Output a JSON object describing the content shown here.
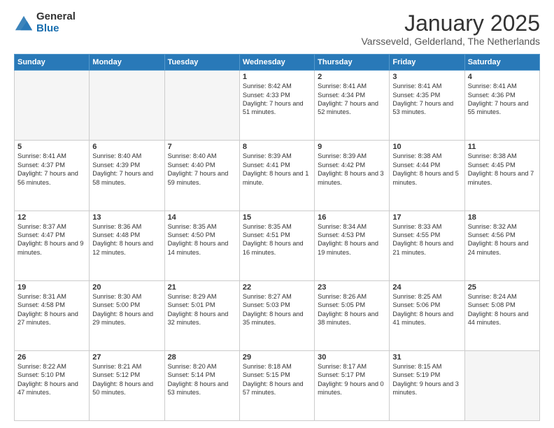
{
  "header": {
    "logo_general": "General",
    "logo_blue": "Blue",
    "month_title": "January 2025",
    "location": "Varsseveld, Gelderland, The Netherlands"
  },
  "days_of_week": [
    "Sunday",
    "Monday",
    "Tuesday",
    "Wednesday",
    "Thursday",
    "Friday",
    "Saturday"
  ],
  "weeks": [
    [
      {
        "day": "",
        "info": ""
      },
      {
        "day": "",
        "info": ""
      },
      {
        "day": "",
        "info": ""
      },
      {
        "day": "1",
        "info": "Sunrise: 8:42 AM\nSunset: 4:33 PM\nDaylight: 7 hours\nand 51 minutes."
      },
      {
        "day": "2",
        "info": "Sunrise: 8:41 AM\nSunset: 4:34 PM\nDaylight: 7 hours\nand 52 minutes."
      },
      {
        "day": "3",
        "info": "Sunrise: 8:41 AM\nSunset: 4:35 PM\nDaylight: 7 hours\nand 53 minutes."
      },
      {
        "day": "4",
        "info": "Sunrise: 8:41 AM\nSunset: 4:36 PM\nDaylight: 7 hours\nand 55 minutes."
      }
    ],
    [
      {
        "day": "5",
        "info": "Sunrise: 8:41 AM\nSunset: 4:37 PM\nDaylight: 7 hours\nand 56 minutes."
      },
      {
        "day": "6",
        "info": "Sunrise: 8:40 AM\nSunset: 4:39 PM\nDaylight: 7 hours\nand 58 minutes."
      },
      {
        "day": "7",
        "info": "Sunrise: 8:40 AM\nSunset: 4:40 PM\nDaylight: 7 hours\nand 59 minutes."
      },
      {
        "day": "8",
        "info": "Sunrise: 8:39 AM\nSunset: 4:41 PM\nDaylight: 8 hours\nand 1 minute."
      },
      {
        "day": "9",
        "info": "Sunrise: 8:39 AM\nSunset: 4:42 PM\nDaylight: 8 hours\nand 3 minutes."
      },
      {
        "day": "10",
        "info": "Sunrise: 8:38 AM\nSunset: 4:44 PM\nDaylight: 8 hours\nand 5 minutes."
      },
      {
        "day": "11",
        "info": "Sunrise: 8:38 AM\nSunset: 4:45 PM\nDaylight: 8 hours\nand 7 minutes."
      }
    ],
    [
      {
        "day": "12",
        "info": "Sunrise: 8:37 AM\nSunset: 4:47 PM\nDaylight: 8 hours\nand 9 minutes."
      },
      {
        "day": "13",
        "info": "Sunrise: 8:36 AM\nSunset: 4:48 PM\nDaylight: 8 hours\nand 12 minutes."
      },
      {
        "day": "14",
        "info": "Sunrise: 8:35 AM\nSunset: 4:50 PM\nDaylight: 8 hours\nand 14 minutes."
      },
      {
        "day": "15",
        "info": "Sunrise: 8:35 AM\nSunset: 4:51 PM\nDaylight: 8 hours\nand 16 minutes."
      },
      {
        "day": "16",
        "info": "Sunrise: 8:34 AM\nSunset: 4:53 PM\nDaylight: 8 hours\nand 19 minutes."
      },
      {
        "day": "17",
        "info": "Sunrise: 8:33 AM\nSunset: 4:55 PM\nDaylight: 8 hours\nand 21 minutes."
      },
      {
        "day": "18",
        "info": "Sunrise: 8:32 AM\nSunset: 4:56 PM\nDaylight: 8 hours\nand 24 minutes."
      }
    ],
    [
      {
        "day": "19",
        "info": "Sunrise: 8:31 AM\nSunset: 4:58 PM\nDaylight: 8 hours\nand 27 minutes."
      },
      {
        "day": "20",
        "info": "Sunrise: 8:30 AM\nSunset: 5:00 PM\nDaylight: 8 hours\nand 29 minutes."
      },
      {
        "day": "21",
        "info": "Sunrise: 8:29 AM\nSunset: 5:01 PM\nDaylight: 8 hours\nand 32 minutes."
      },
      {
        "day": "22",
        "info": "Sunrise: 8:27 AM\nSunset: 5:03 PM\nDaylight: 8 hours\nand 35 minutes."
      },
      {
        "day": "23",
        "info": "Sunrise: 8:26 AM\nSunset: 5:05 PM\nDaylight: 8 hours\nand 38 minutes."
      },
      {
        "day": "24",
        "info": "Sunrise: 8:25 AM\nSunset: 5:06 PM\nDaylight: 8 hours\nand 41 minutes."
      },
      {
        "day": "25",
        "info": "Sunrise: 8:24 AM\nSunset: 5:08 PM\nDaylight: 8 hours\nand 44 minutes."
      }
    ],
    [
      {
        "day": "26",
        "info": "Sunrise: 8:22 AM\nSunset: 5:10 PM\nDaylight: 8 hours\nand 47 minutes."
      },
      {
        "day": "27",
        "info": "Sunrise: 8:21 AM\nSunset: 5:12 PM\nDaylight: 8 hours\nand 50 minutes."
      },
      {
        "day": "28",
        "info": "Sunrise: 8:20 AM\nSunset: 5:14 PM\nDaylight: 8 hours\nand 53 minutes."
      },
      {
        "day": "29",
        "info": "Sunrise: 8:18 AM\nSunset: 5:15 PM\nDaylight: 8 hours\nand 57 minutes."
      },
      {
        "day": "30",
        "info": "Sunrise: 8:17 AM\nSunset: 5:17 PM\nDaylight: 9 hours\nand 0 minutes."
      },
      {
        "day": "31",
        "info": "Sunrise: 8:15 AM\nSunset: 5:19 PM\nDaylight: 9 hours\nand 3 minutes."
      },
      {
        "day": "",
        "info": ""
      }
    ]
  ]
}
